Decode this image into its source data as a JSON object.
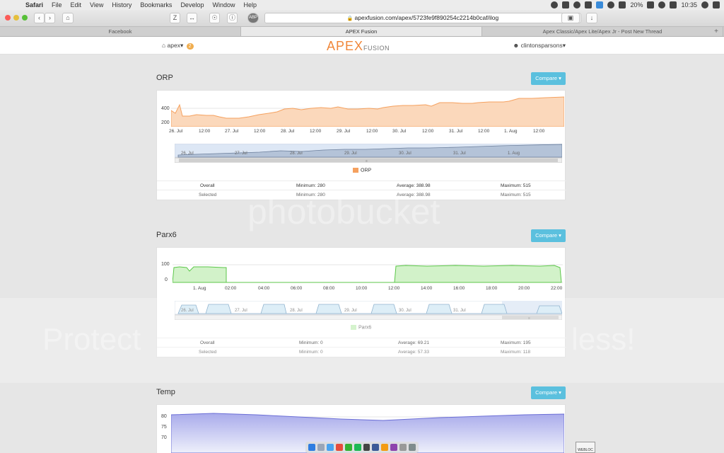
{
  "menubar": {
    "app": "Safari",
    "items": [
      "File",
      "Edit",
      "View",
      "History",
      "Bookmarks",
      "Develop",
      "Window",
      "Help"
    ],
    "battery": "20%",
    "clock": "10:35"
  },
  "toolbar": {
    "url": "apexfusion.com/apex/5723fe9f890254c2214b0caf/ilog",
    "z_label": "Z",
    "abp_label": "ABP"
  },
  "tabs": [
    "Facebook",
    "APEX Fusion",
    "Apex Classic/Apex Lite/Apex Jr - Post New Thread"
  ],
  "app": {
    "apex_menu": "apex",
    "badge": "2",
    "logo_main": "APEX",
    "logo_sub": "FUSION",
    "user": "clintonsparsons",
    "compare_label": "Compare"
  },
  "orp": {
    "title": "ORP",
    "y_ticks": [
      "400",
      "200"
    ],
    "x_ticks": [
      "26. Jul",
      "12:00",
      "27. Jul",
      "12:00",
      "28. Jul",
      "12:00",
      "29. Jul",
      "12:00",
      "30. Jul",
      "12:00",
      "31. Jul",
      "12:00",
      "1. Aug",
      "12:00"
    ],
    "nav_labels": [
      "26. Jul",
      "27. Jul",
      "28. Jul",
      "29. Jul",
      "30. Jul",
      "31. Jul",
      "1. Aug"
    ],
    "legend": "ORP",
    "color": "#f5a15f",
    "stats": {
      "overall": {
        "label": "Overall",
        "min": "Minimum: 280",
        "avg": "Average: 388.98",
        "max": "Maximum: 515"
      },
      "selected": {
        "label": "Selected",
        "min": "Minimum: 280",
        "avg": "Average: 388.98",
        "max": "Maximum: 515"
      }
    }
  },
  "parx6": {
    "title": "Parx6",
    "y_ticks": [
      "100",
      "0"
    ],
    "x_ticks": [
      "1. Aug",
      "02:00",
      "04:00",
      "06:00",
      "08:00",
      "10:00",
      "12:00",
      "14:00",
      "16:00",
      "18:00",
      "20:00",
      "22:00"
    ],
    "nav_labels": [
      "26. Jul",
      "27. Jul",
      "28. Jul",
      "29. Jul",
      "30. Jul",
      "31. Jul"
    ],
    "legend": "Parx6",
    "color": "#7cd36b",
    "stats": {
      "overall": {
        "label": "Overall",
        "min": "Minimum: 0",
        "avg": "Average: 69.21",
        "max": "Maximum: 195"
      },
      "selected": {
        "label": "Selected",
        "min": "Minimum: 0",
        "avg": "Average: 57.33",
        "max": "Maximum: 118"
      }
    }
  },
  "temp": {
    "title": "Temp",
    "y_ticks": [
      "80",
      "75",
      "70"
    ],
    "color": "#8c8fe0"
  },
  "watermark": {
    "brand": "photobucket",
    "left": "Protect",
    "right": "less!"
  },
  "dock": {
    "webloc": "WEBLOC"
  },
  "chart_data": [
    {
      "type": "area",
      "title": "ORP",
      "x": [
        "26. Jul",
        "27. Jul",
        "28. Jul",
        "29. Jul",
        "30. Jul",
        "31. Jul",
        "1. Aug",
        "1. Aug 12:00"
      ],
      "series": [
        {
          "name": "ORP",
          "values": [
            300,
            285,
            335,
            350,
            365,
            395,
            415,
            505
          ]
        }
      ],
      "ylim": [
        200,
        520
      ]
    },
    {
      "type": "area",
      "title": "Parx6",
      "x": [
        "00:00",
        "02:00",
        "04:00",
        "06:00",
        "08:00",
        "10:00",
        "12:00",
        "14:00",
        "16:00",
        "18:00",
        "20:00",
        "22:00"
      ],
      "series": [
        {
          "name": "Parx6",
          "values": [
            100,
            100,
            0,
            0,
            0,
            0,
            110,
            110,
            108,
            110,
            108,
            110
          ]
        }
      ],
      "ylim": [
        0,
        120
      ]
    },
    {
      "type": "area",
      "title": "Temp",
      "series": [
        {
          "values": [
            79.5,
            80.2,
            78.8,
            79.4,
            80.6
          ]
        }
      ],
      "ylim": [
        70,
        82
      ]
    }
  ]
}
